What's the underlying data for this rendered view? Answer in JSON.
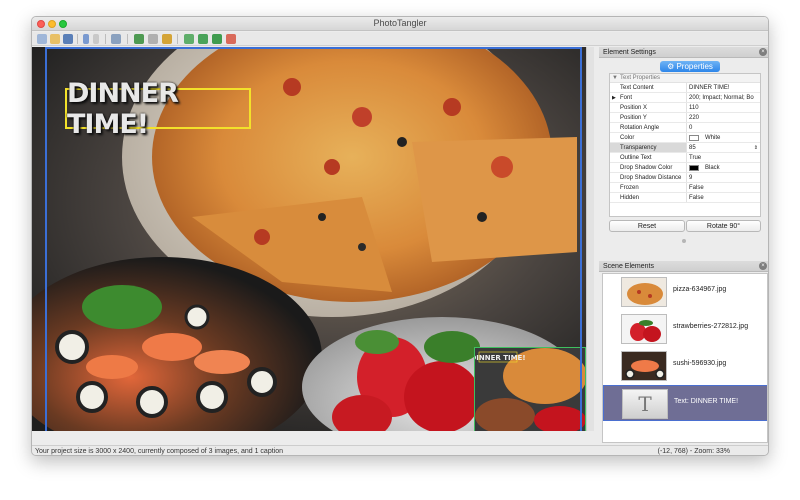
{
  "window": {
    "title": "PhotoTangler"
  },
  "caption": {
    "text": "DINNER TIME!"
  },
  "overview_caption": "DINNER TIME!",
  "element_settings": {
    "title": "Element Settings",
    "tab_label": "Properties",
    "section_label": "Text Properties",
    "rows": [
      {
        "key": "Text Content",
        "value": "DINNER TIME!"
      },
      {
        "key": "Font",
        "value": "200; Impact; Normal; Bo"
      },
      {
        "key": "Position X",
        "value": "110"
      },
      {
        "key": "Position Y",
        "value": "220"
      },
      {
        "key": "Rotation Angle",
        "value": "0"
      },
      {
        "key": "Color",
        "value": "White"
      },
      {
        "key": "Transparency",
        "value": "85"
      },
      {
        "key": "Outline Text",
        "value": "True"
      },
      {
        "key": "Drop Shadow Color",
        "value": "Black"
      },
      {
        "key": "Drop Shadow Distance",
        "value": "9"
      },
      {
        "key": "Frozen",
        "value": "False"
      },
      {
        "key": "Hidden",
        "value": "False"
      }
    ],
    "reset_label": "Reset",
    "rotate_label": "Rotate 90°"
  },
  "scene_elements": {
    "title": "Scene Elements",
    "items": [
      {
        "label": "pizza-634967.jpg"
      },
      {
        "label": "strawberries-272812.jpg"
      },
      {
        "label": "sushi-596930.jpg"
      },
      {
        "label": "Text: DINNER TIME!",
        "thumb_glyph": "T"
      }
    ]
  },
  "status": {
    "left": "Your project size is 3000 x 2400, currently composed of 3 images, and 1 caption",
    "right": "(-12, 768) - Zoom: 33%"
  },
  "colors": {
    "accent": "#2d86ea",
    "selection_frame": "#f3e12a",
    "overview_frame": "#3fbf5f",
    "canvas_frame": "#3b6fd6"
  }
}
